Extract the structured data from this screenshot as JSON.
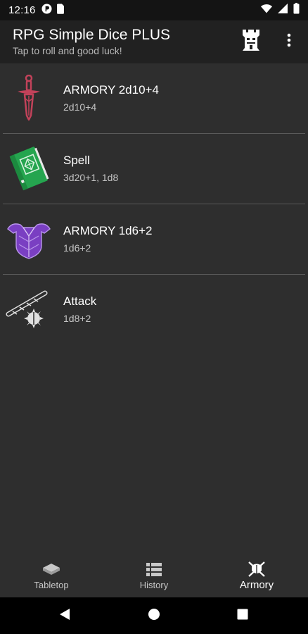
{
  "status_bar": {
    "time": "12:16",
    "left_icons": [
      "photo-mode-icon",
      "sim-card-icon"
    ],
    "right_icons": [
      "wifi-icon",
      "signal-icon",
      "battery-icon"
    ]
  },
  "app_bar": {
    "title": "RPG Simple Dice PLUS",
    "subtitle": "Tap to roll and good luck!",
    "actions": [
      "tower-icon",
      "overflow-menu-icon"
    ]
  },
  "items": [
    {
      "name": "ARMORY 2d10+4",
      "formula": "2d10+4",
      "icon": "dagger-icon",
      "color": "#c2425a"
    },
    {
      "name": "Spell",
      "formula": "3d20+1, 1d8",
      "icon": "spellbook-icon",
      "color": "#25a54f"
    },
    {
      "name": "ARMORY 1d6+2",
      "formula": "1d6+2",
      "icon": "armor-icon",
      "color": "#7a3fc2"
    },
    {
      "name": "Attack",
      "formula": "1d8+2",
      "icon": "mace-icon",
      "color": "#e0e0e0"
    }
  ],
  "bottom_nav": {
    "active": "Armory",
    "items": [
      {
        "label": "Tabletop",
        "icon": "tabletop-icon"
      },
      {
        "label": "History",
        "icon": "history-icon"
      },
      {
        "label": "Armory",
        "icon": "armory-icon"
      }
    ]
  },
  "system_nav": [
    "back-icon",
    "home-icon",
    "recents-icon"
  ]
}
